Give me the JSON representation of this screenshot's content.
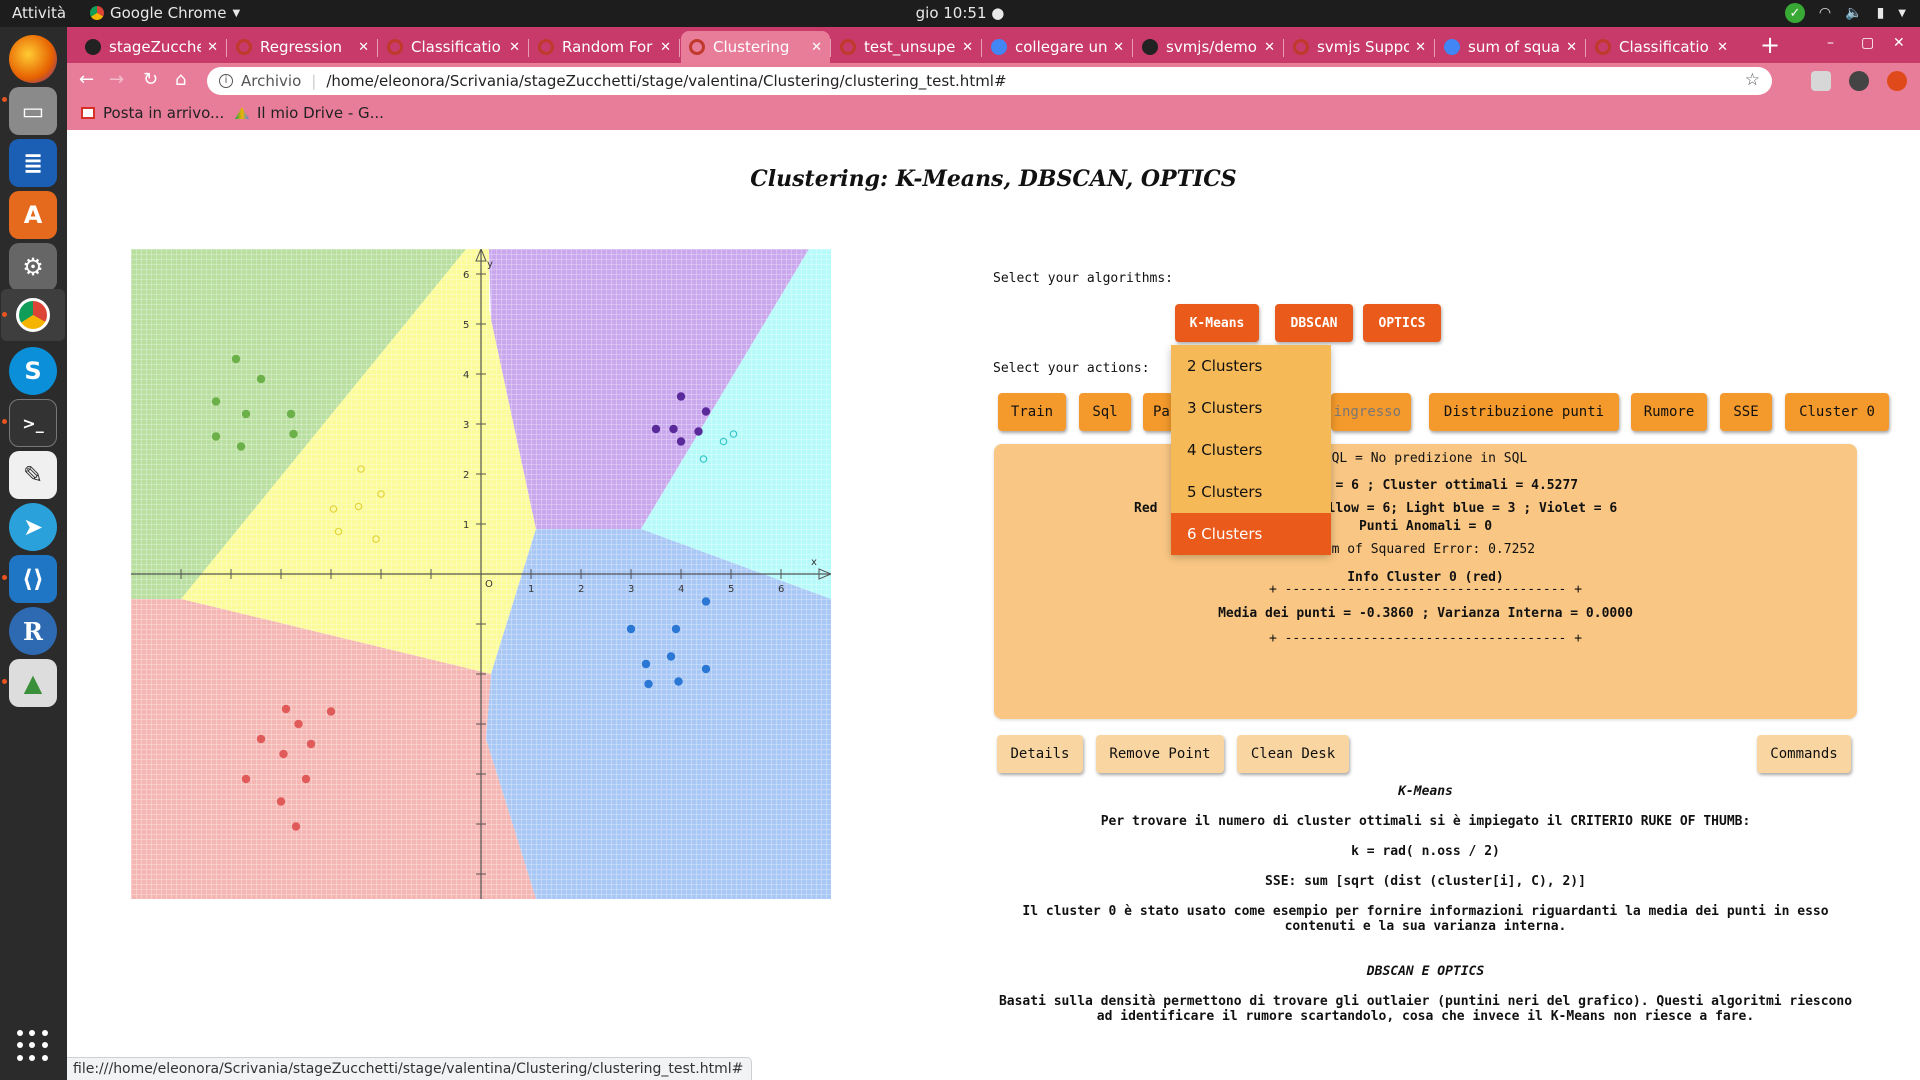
{
  "system": {
    "activities": "Attività",
    "app_name": "Google Chrome",
    "clock": "gio 10:51"
  },
  "tabs": [
    {
      "label": "stageZucche",
      "icon": "github-icon",
      "color": "#222222"
    },
    {
      "label": "Regression",
      "icon": "page-icon",
      "color": "#c0392b"
    },
    {
      "label": "Classificatio",
      "icon": "page-icon",
      "color": "#c0392b"
    },
    {
      "label": "Random For",
      "icon": "page-icon",
      "color": "#c0392b"
    },
    {
      "label": "Clustering",
      "icon": "page-icon",
      "color": "#c0392b",
      "active": true
    },
    {
      "label": "test_unsupe",
      "icon": "page-icon",
      "color": "#c0392b"
    },
    {
      "label": "collegare un",
      "icon": "google-icon",
      "color": "#4285f4"
    },
    {
      "label": "svmjs/demo",
      "icon": "github-icon",
      "color": "#222222"
    },
    {
      "label": "svmjs Suppo",
      "icon": "page-icon",
      "color": "#c0392b"
    },
    {
      "label": "sum of squa",
      "icon": "google-icon",
      "color": "#4285f4"
    },
    {
      "label": "Classificatio",
      "icon": "page-icon",
      "color": "#c0392b"
    }
  ],
  "address": {
    "scheme_label": "Archivio",
    "url": "/home/eleonora/Scrivania/stageZucchetti/stage/valentina/Clustering/clustering_test.html#"
  },
  "bookmarks": [
    {
      "label": "Posta in arrivo...",
      "icon": "gmail-icon"
    },
    {
      "label": "Il mio Drive - G...",
      "icon": "drive-icon"
    }
  ],
  "page": {
    "title": "Clustering: K-Means, DBSCAN, OPTICS",
    "select_algorithms": "Select your algorithms:",
    "select_actions": "Select your actions:",
    "algorithms": [
      "K-Means",
      "DBSCAN",
      "OPTICS"
    ],
    "actions": [
      "Train",
      "Sql",
      "Pa",
      "ingresso",
      "Distribuzione punti",
      "Rumore",
      "SSE",
      "Cluster 0"
    ],
    "dropdown": {
      "options": [
        "2 Clusters",
        "3 Clusters",
        "4 Clusters",
        "5 Clusters",
        "6 Clusters"
      ],
      "selected": "6 Clusters"
    },
    "info": {
      "sql": "SQL = No predizione in SQL",
      "clusters": "Cluster = 6 ; Cluster ottimali = 4.5277",
      "counts_left": "Red",
      "counts_right": "een = 8 ; Yellow = 6; Light blue = 3 ; Violet = 6",
      "anomalies": "Punti Anomali = 0",
      "sse": "Sum of Squared Error: 0.7252",
      "cluster0_title": "Info Cluster 0 (red)",
      "divider": "+ ------------------------------------ +",
      "mean_var": "Media dei punti = -0.3860 ; Varianza Interna = 0.0000"
    },
    "bottom_buttons": [
      "Details",
      "Remove Point",
      "Clean Desk",
      "Commands"
    ],
    "kmeans_title": "K-Means",
    "kmeans_text1": "Per trovare il numero di cluster ottimali si è impiegato il CRITERIO RUKE OF THUMB:",
    "kmeans_formula": "k = rad( n.oss / 2)",
    "kmeans_sse": "SSE: sum [sqrt (dist (cluster[i], C), 2)]",
    "kmeans_text2_a": "Il cluster 0 è stato usato come esempio per fornire informazioni riguardanti la media dei punti in esso",
    "kmeans_text2_b": "contenuti e la sua varianza interna.",
    "dbscan_title": "DBSCAN E OPTICS",
    "dbscan_text_a": "Basati sulla densità permettono di trovare gli outlaier (puntini neri del grafico). Questi algoritmi riescono",
    "dbscan_text_b": "ad identificare il rumore scartandolo, cosa che invece il K-Means non riesce a fare."
  },
  "plot": {
    "x_ticks": [
      "1",
      "2",
      "3",
      "4",
      "5",
      "6"
    ],
    "y_ticks": [
      "1",
      "2",
      "3",
      "4",
      "5",
      "6"
    ],
    "origin_label": "O",
    "x_label": "x",
    "y_label": "y",
    "colors": {
      "red": "#e05a5a",
      "green": "#6cb04a",
      "yellow": "#e2d23a",
      "violet": "#5a2a9a",
      "lightblue": "#36c5c8",
      "blue": "#2b77d4"
    }
  },
  "status_url": "file:///home/eleonora/Scrivania/stageZucchetti/stage/valentina/Clustering/clustering_test.html#"
}
